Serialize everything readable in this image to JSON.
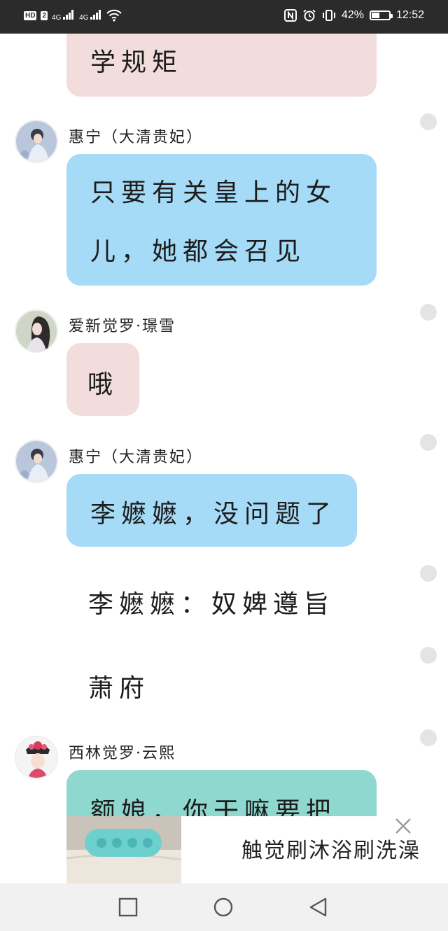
{
  "status_bar": {
    "hd_label": "HD",
    "sim_slot": "2",
    "network1": "4G",
    "network2": "4G",
    "battery_percent": "42%",
    "battery_level": 0.42,
    "time": "12:52"
  },
  "messages": [
    {
      "type": "bubble",
      "color": "#f2dcdc",
      "text_lines": [
        "学规矩"
      ]
    },
    {
      "type": "bubble",
      "sender": "惠宁（大清贵妃）",
      "color": "#a6dbf7",
      "text_lines": [
        "只要有关皇上的女",
        "儿，她都会召见"
      ]
    },
    {
      "type": "bubble",
      "sender": "爱新觉罗·璟雪",
      "color": "#f2dcdc",
      "text_lines": [
        "哦"
      ]
    },
    {
      "type": "bubble",
      "sender": "惠宁（大清贵妃）",
      "color": "#a6dbf7",
      "text_lines": [
        "李嬷嬷，没问题了"
      ]
    },
    {
      "type": "plain",
      "text": "李嬷嬷：奴婢遵旨"
    },
    {
      "type": "plain",
      "text": "萧府"
    },
    {
      "type": "bubble",
      "sender": "西林觉罗·云熙",
      "color": "#8fd8d0",
      "text_lines": [
        "额娘，你干嘛要把"
      ]
    }
  ],
  "ad": {
    "title": "触觉刷沐浴刷洗澡",
    "close_icon": "close-icon"
  },
  "navbar": {
    "icons": [
      "square-recent-icon",
      "circle-home-icon",
      "triangle-back-icon"
    ]
  }
}
